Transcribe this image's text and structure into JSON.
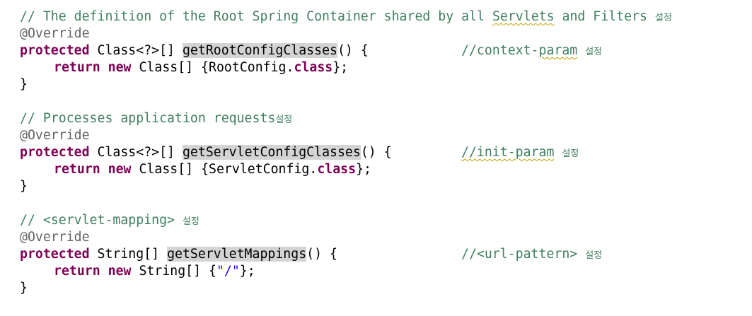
{
  "editor": {
    "block1": {
      "comment_prefix": "// The definition of the Root Spring Container shared by all ",
      "comment_squiggle": "Servlets",
      "comment_suffix": " and Filters ",
      "comment_ko": "설정",
      "annotation": "@Override",
      "modifier": "protected",
      "return_type": " Class<?>[] ",
      "method_name": "getRootConfigClasses",
      "signature_end": "() {",
      "trail_prefix": "//context-",
      "trail_squiggle": "param",
      "trail_ko": "설정",
      "return_kw": "return",
      "new_kw": "new",
      "expr_start": " Class[] {RootConfig.",
      "class_kw": "class",
      "expr_end": "};",
      "close": "}"
    },
    "block2": {
      "comment": "// Processes application requests",
      "comment_ko": "설정",
      "annotation": "@Override",
      "modifier": "protected",
      "return_type": " Class<?>[] ",
      "method_name": "getServletConfigClasses",
      "signature_end": "() {",
      "trail_squiggle": "//init-param",
      "trail_ko": "설정",
      "return_kw": "return",
      "new_kw": "new",
      "expr_start": " Class[] {ServletConfig.",
      "class_kw": "class",
      "expr_end": "};",
      "close": "}"
    },
    "block3": {
      "comment": "// <servlet-mapping> ",
      "comment_ko": "설정",
      "annotation": "@Override",
      "modifier": "protected",
      "return_type": " String[] ",
      "method_name": "getServletMappings",
      "signature_end": "() {",
      "trail": "//<url-pattern> ",
      "trail_ko": "설정",
      "return_kw": "return",
      "new_kw": "new",
      "expr_start": " String[] {",
      "string_literal": "\"/\"",
      "expr_end": "};",
      "close": "}"
    }
  },
  "colors": {
    "comment": "#3f7f5f",
    "keyword": "#7f0055",
    "annotation": "#646464",
    "string": "#2a00ff",
    "highlight": "#d4d4d4"
  }
}
